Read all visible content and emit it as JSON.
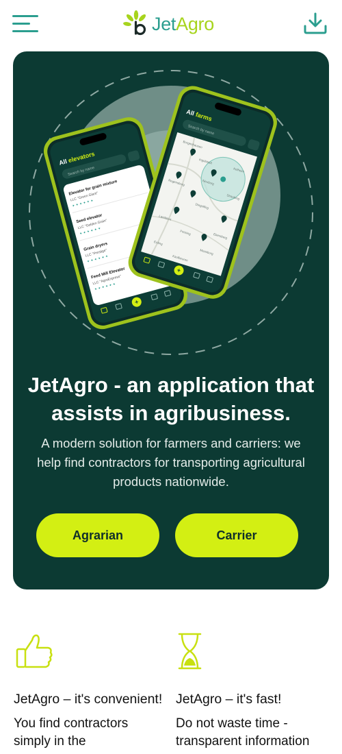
{
  "header": {
    "logo": {
      "part1": "Jet",
      "part2": "Agro"
    },
    "menu_icon": "hamburger-menu-icon",
    "download_icon": "download-icon"
  },
  "hero": {
    "title": "JetAgro - an application that assists in agribusiness.",
    "subtitle": "A modern solution for farmers and carriers: we help find contractors for transporting agricultural products nationwide.",
    "buttons": {
      "agrarian": "Agrarian",
      "carrier": "Carrier"
    }
  },
  "phone_left": {
    "title_prefix": "All",
    "title_highlight": "elevators",
    "search_placeholder": "Search by name",
    "items": [
      {
        "name": "Elevator for grain mixture",
        "company": "LLC \"Green Giant\""
      },
      {
        "name": "Seed elevator",
        "company": "LLC \"Golden Grain\""
      },
      {
        "name": "Grain dryers",
        "company": "LLC \"Prestige\""
      },
      {
        "name": "Feed Mill Elevator",
        "company": "LLC \"AgroExpress\""
      }
    ],
    "nav": [
      "Map",
      "Chat",
      "",
      "Orders",
      "Settings"
    ]
  },
  "phone_right": {
    "title_prefix": "All",
    "title_highlight": "farms",
    "search_placeholder": "Search by name",
    "map_labels": [
      "Burgenhausen",
      "Ingolstadt",
      "Regensburg",
      "Neuburg",
      "Kelheim",
      "Straubing",
      "Dingolfing",
      "Landshut",
      "Freising",
      "Moosburg",
      "Erding",
      "Ebersberg",
      "Kaufbeuren"
    ],
    "nav": [
      "Map",
      "Chat",
      "",
      "Orders",
      "Settings"
    ]
  },
  "features": [
    {
      "icon": "thumbs-up-icon",
      "title": "JetAgro – it's convenient!",
      "text": "You find contractors simply in the"
    },
    {
      "icon": "hourglass-icon",
      "title": "JetAgro – it's fast!",
      "text": "Do not waste time - transparent information"
    }
  ],
  "colors": {
    "brand_teal": "#2b9e8f",
    "brand_lime": "#d3ef13",
    "hero_bg": "#0c3a33"
  }
}
